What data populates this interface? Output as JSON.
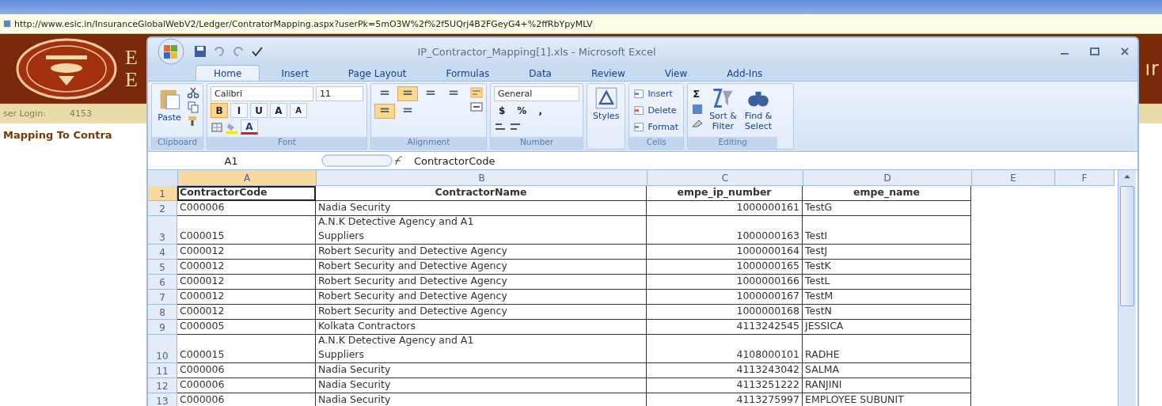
{
  "browser": {
    "url": "http://www.esic.in/InsuranceGlobalWebV2/Ledger/ContratorMapping.aspx?userPk=5mO3W%2f%2f5UQrj4B2FGeyG4+%2ffRbYpyMLV",
    "banner_letters": [
      "E",
      "E"
    ],
    "banner_right": "ır",
    "login_label": "ser Login:",
    "login_value": "4153",
    "page_heading": "Mapping To Contra"
  },
  "excel": {
    "title": "IP_Contractor_Mapping[1].xls - Microsoft Excel",
    "tabs": [
      {
        "label": "Home",
        "selected": true
      },
      {
        "label": "Insert",
        "selected": false
      },
      {
        "label": "Page Layout",
        "selected": false
      },
      {
        "label": "Formulas",
        "selected": false
      },
      {
        "label": "Data",
        "selected": false
      },
      {
        "label": "Review",
        "selected": false
      },
      {
        "label": "View",
        "selected": false
      },
      {
        "label": "Add-Ins",
        "selected": false
      }
    ],
    "ribbon": {
      "paste": "Paste",
      "clipboard": "Clipboard",
      "font_name": "Calibri",
      "font_size": "11",
      "font_buttons": [
        {
          "label": "B",
          "selected": true
        },
        {
          "label": "I",
          "selected": false
        },
        {
          "label": "U",
          "selected": false
        }
      ],
      "grow": "A",
      "shrink": "A",
      "font_color": "A",
      "font": "Font",
      "align_buttons": [
        {
          "selected": false
        },
        {
          "selected": true
        },
        {
          "selected": false
        },
        {
          "selected": false
        },
        {
          "selected": true
        },
        {
          "selected": false
        }
      ],
      "alignment": "Alignment",
      "number_format": "General",
      "number_buttons": [
        "$",
        "%",
        ","
      ],
      "number": "Number",
      "styles": "Styles",
      "cells": [
        "Insert",
        "Delete",
        "Format"
      ],
      "cells_label": "Cells",
      "sigma": "Σ",
      "sort": [
        "Sort &",
        "Filter"
      ],
      "find": [
        "Find &",
        "Select"
      ],
      "editing": "Editing"
    },
    "name_box": "A1",
    "formula": "ContractorCode",
    "columns": [
      {
        "letter": "A",
        "selected": true
      },
      {
        "letter": "B",
        "selected": false
      },
      {
        "letter": "C",
        "selected": false
      },
      {
        "letter": "D",
        "selected": false
      },
      {
        "letter": "E",
        "selected": false
      },
      {
        "letter": "F",
        "selected": false
      }
    ],
    "rows": [
      {
        "number": "1",
        "kind": "header",
        "selected": true,
        "wrapped": false,
        "cells": [
          "ContractorCode",
          "ContractorName",
          "empe_ip_number",
          "empe_name"
        ]
      },
      {
        "number": "2",
        "kind": "data",
        "selected": false,
        "wrapped": false,
        "cells": [
          "C000006",
          "Nadia Security",
          "1000000161",
          "TestG"
        ]
      },
      {
        "number": "3",
        "kind": "data",
        "selected": false,
        "wrapped": true,
        "cells": [
          "C000015",
          "A.N.K Detective Agency and A1 Suppliers",
          "1000000163",
          "TestI"
        ]
      },
      {
        "number": "4",
        "kind": "data",
        "selected": false,
        "wrapped": false,
        "cells": [
          "C000012",
          "Robert Security and Detective Agency",
          "1000000164",
          "TestJ"
        ]
      },
      {
        "number": "5",
        "kind": "data",
        "selected": false,
        "wrapped": false,
        "cells": [
          "C000012",
          "Robert Security and Detective Agency",
          "1000000165",
          "TestK"
        ]
      },
      {
        "number": "6",
        "kind": "data",
        "selected": false,
        "wrapped": false,
        "cells": [
          "C000012",
          "Robert Security and Detective Agency",
          "1000000166",
          "TestL"
        ]
      },
      {
        "number": "7",
        "kind": "data",
        "selected": false,
        "wrapped": false,
        "cells": [
          "C000012",
          "Robert Security and Detective Agency",
          "1000000167",
          "TestM"
        ]
      },
      {
        "number": "8",
        "kind": "data",
        "selected": false,
        "wrapped": false,
        "cells": [
          "C000012",
          "Robert Security and Detective Agency",
          "1000000168",
          "TestN"
        ]
      },
      {
        "number": "9",
        "kind": "data",
        "selected": false,
        "wrapped": false,
        "cells": [
          "C000005",
          "Kolkata Contractors",
          "4113242545",
          "JESSICA"
        ]
      },
      {
        "number": "10",
        "kind": "data",
        "selected": false,
        "wrapped": true,
        "cells": [
          "C000015",
          "A.N.K Detective Agency and A1 Suppliers",
          "4108000101",
          "RADHE"
        ]
      },
      {
        "number": "11",
        "kind": "data",
        "selected": false,
        "wrapped": false,
        "cells": [
          "C000006",
          "Nadia Security",
          "4113243042",
          "SALMA"
        ]
      },
      {
        "number": "12",
        "kind": "data",
        "selected": false,
        "wrapped": false,
        "cells": [
          "C000006",
          "Nadia Security",
          "4113251222",
          "RANJINI"
        ]
      },
      {
        "number": "13",
        "kind": "data",
        "selected": false,
        "wrapped": false,
        "cells": [
          "C000006",
          "Nadia Security",
          "4113275997",
          "EMPLOYEE SUBUNIT"
        ]
      }
    ]
  }
}
